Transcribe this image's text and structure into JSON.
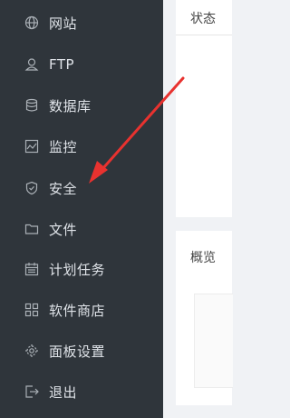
{
  "sidebar": {
    "items": [
      {
        "label": "网站",
        "icon": "globe-icon"
      },
      {
        "label": "FTP",
        "icon": "ftp-icon"
      },
      {
        "label": "数据库",
        "icon": "database-icon"
      },
      {
        "label": "监控",
        "icon": "monitor-icon"
      },
      {
        "label": "安全",
        "icon": "shield-icon"
      },
      {
        "label": "文件",
        "icon": "folder-icon"
      },
      {
        "label": "计划任务",
        "icon": "calendar-icon"
      },
      {
        "label": "软件商店",
        "icon": "app-grid-icon"
      },
      {
        "label": "面板设置",
        "icon": "gear-icon"
      },
      {
        "label": "退出",
        "icon": "logout-icon"
      }
    ]
  },
  "main": {
    "status_title": "状态",
    "overview_title": "概览"
  },
  "colors": {
    "sidebar_bg": "#2f353b",
    "sidebar_text": "#dfe3e8",
    "page_bg": "#f0f2f5",
    "annotation_arrow": "#e8322f"
  }
}
